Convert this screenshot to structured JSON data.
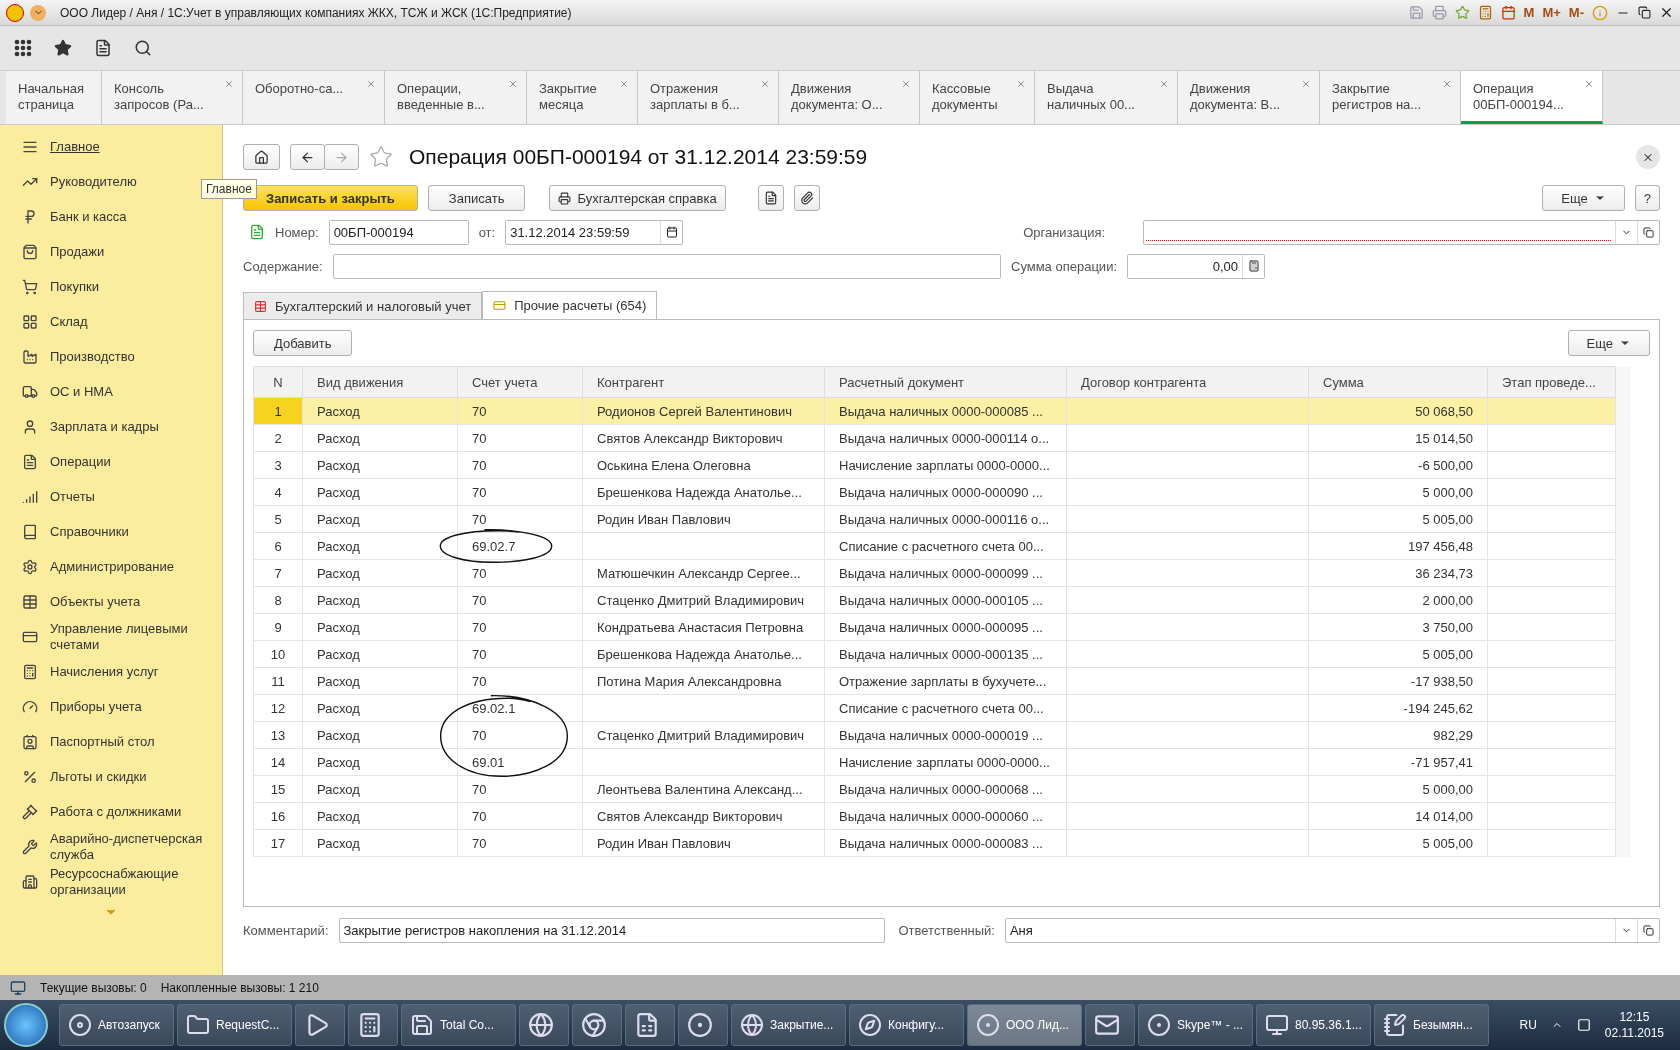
{
  "title_bar": {
    "title": "ООО Лидер / Аня / 1С:Учет в управляющих компаниях ЖКХ, ТСЖ и ЖСК  (1С:Предприятие)",
    "memory_buttons": [
      "M",
      "M+",
      "M-"
    ]
  },
  "open_tabs": [
    {
      "lines": [
        "Начальная",
        "страница"
      ],
      "closable": false,
      "selected": false
    },
    {
      "lines": [
        "Консоль",
        "запросов (Ра..."
      ],
      "closable": true,
      "selected": false
    },
    {
      "lines": [
        "Оборотно-са..."
      ],
      "closable": true,
      "selected": false
    },
    {
      "lines": [
        "Операции,",
        "введенные в..."
      ],
      "closable": true,
      "selected": false
    },
    {
      "lines": [
        "Закрытие",
        "месяца"
      ],
      "closable": true,
      "selected": false
    },
    {
      "lines": [
        "Отражения",
        "зарплаты в б..."
      ],
      "closable": true,
      "selected": false
    },
    {
      "lines": [
        "Движения",
        "документа: О..."
      ],
      "closable": true,
      "selected": false
    },
    {
      "lines": [
        "Кассовые",
        "документы"
      ],
      "closable": true,
      "selected": false
    },
    {
      "lines": [
        "Выдача",
        "наличных 00..."
      ],
      "closable": true,
      "selected": false
    },
    {
      "lines": [
        "Движения",
        "документа: В..."
      ],
      "closable": true,
      "selected": false
    },
    {
      "lines": [
        "Закрытие",
        "регистров на..."
      ],
      "closable": true,
      "selected": false
    },
    {
      "lines": [
        "Операция",
        "00БП-000194..."
      ],
      "closable": true,
      "selected": true
    }
  ],
  "sidebar": {
    "items": [
      {
        "label": "Главное",
        "selected": true
      },
      {
        "label": "Руководителю",
        "selected": false
      },
      {
        "label": "Банк и касса",
        "selected": false
      },
      {
        "label": "Продажи",
        "selected": false
      },
      {
        "label": "Покупки",
        "selected": false
      },
      {
        "label": "Склад",
        "selected": false
      },
      {
        "label": "Производство",
        "selected": false
      },
      {
        "label": "ОС и НМА",
        "selected": false
      },
      {
        "label": "Зарплата и кадры",
        "selected": false
      },
      {
        "label": "Операции",
        "selected": false
      },
      {
        "label": "Отчеты",
        "selected": false
      },
      {
        "label": "Справочники",
        "selected": false
      },
      {
        "label": "Администрирование",
        "selected": false
      },
      {
        "label": "Объекты учета",
        "selected": false
      },
      {
        "label": "Управление лицевыми счетами",
        "selected": false
      },
      {
        "label": "Начисления услуг",
        "selected": false
      },
      {
        "label": "Приборы учета",
        "selected": false
      },
      {
        "label": "Паспортный стол",
        "selected": false
      },
      {
        "label": "Льготы и скидки",
        "selected": false
      },
      {
        "label": "Работа с должниками",
        "selected": false
      },
      {
        "label": "Аварийно-диспетчерская служба",
        "selected": false
      },
      {
        "label": "Ресурсоснабжающие организации",
        "selected": false
      }
    ],
    "tooltip": "Главное"
  },
  "form": {
    "title": "Операция 00БП-000194 от 31.12.2014 23:59:59",
    "commands": {
      "save_close": "Записать и закрыть",
      "save": "Записать",
      "report": "Бухгалтерская справка",
      "more": "Еще",
      "help": "?"
    },
    "number_label": "Номер:",
    "number": "00БП-000194",
    "date_label": "от:",
    "date": "31.12.2014 23:59:59",
    "organization_label": "Организация:",
    "organization_required": true,
    "content_label": "Содержание:",
    "sum_label": "Сумма операции:",
    "sum": "0,00",
    "tabs": [
      {
        "label": "Бухгалтерский и налоговый учет",
        "selected": false
      },
      {
        "label": "Прочие расчеты (654)",
        "selected": true
      }
    ],
    "add_button": "Добавить",
    "table_more": "Еще",
    "columns": [
      "N",
      "Вид движения",
      "Счет учета",
      "Контрагент",
      "Расчетный документ",
      "Договор контрагента",
      "Сумма",
      "Этап проведе..."
    ],
    "rows": [
      {
        "n": "1",
        "movement": "Расход",
        "account": "70",
        "counterparty": "Родионов Сергей Валентинович",
        "document": "Выдача наличных 0000-000085 ...",
        "amount": "50 068,50",
        "selected": true
      },
      {
        "n": "2",
        "movement": "Расход",
        "account": "70",
        "counterparty": "Святов Александр Викторович",
        "document": "Выдача наличных 0000-000114 о...",
        "amount": "15 014,50",
        "selected": false
      },
      {
        "n": "3",
        "movement": "Расход",
        "account": "70",
        "counterparty": "Оськина Елена Олеговна",
        "document": "Начисление зарплаты 0000-0000...",
        "amount": "-6 500,00",
        "selected": false
      },
      {
        "n": "4",
        "movement": "Расход",
        "account": "70",
        "counterparty": "Брешенкова Надежда Анатолье...",
        "document": "Выдача наличных 0000-000090 ...",
        "amount": "5 000,00",
        "selected": false
      },
      {
        "n": "5",
        "movement": "Расход",
        "account": "70",
        "counterparty": "Родин Иван Павлович",
        "document": "Выдача наличных 0000-000116 о...",
        "amount": "5 005,00",
        "selected": false
      },
      {
        "n": "6",
        "movement": "Расход",
        "account": "69.02.7",
        "document": "Списание с расчетного счета 00...",
        "amount": "197 456,48",
        "selected": false
      },
      {
        "n": "7",
        "movement": "Расход",
        "account": "70",
        "counterparty": "Матюшечкин Александр Сергее...",
        "document": "Выдача наличных 0000-000099 ...",
        "amount": "36 234,73",
        "selected": false
      },
      {
        "n": "8",
        "movement": "Расход",
        "account": "70",
        "counterparty": "Стаценко Дмитрий Владимирович",
        "document": "Выдача наличных 0000-000105 ...",
        "amount": "2 000,00",
        "selected": false
      },
      {
        "n": "9",
        "movement": "Расход",
        "account": "70",
        "counterparty": "Кондратьева Анастасия Петровна",
        "document": "Выдача наличных 0000-000095 ...",
        "amount": "3 750,00",
        "selected": false
      },
      {
        "n": "10",
        "movement": "Расход",
        "account": "70",
        "counterparty": "Брешенкова Надежда Анатолье...",
        "document": "Выдача наличных 0000-000135 ...",
        "amount": "5 005,00",
        "selected": false
      },
      {
        "n": "11",
        "movement": "Расход",
        "account": "70",
        "counterparty": "Потина Мария Александровна",
        "document": "Отражение зарплаты в бухучете...",
        "amount": "-17 938,50",
        "selected": false
      },
      {
        "n": "12",
        "movement": "Расход",
        "account": "69.02.1",
        "document": "Списание с расчетного счета 00...",
        "amount": "-194 245,62",
        "selected": false
      },
      {
        "n": "13",
        "movement": "Расход",
        "account": "70",
        "counterparty": "Стаценко Дмитрий Владимирович",
        "document": "Выдача наличных 0000-000019 ...",
        "amount": "982,29",
        "selected": false
      },
      {
        "n": "14",
        "movement": "Расход",
        "account": "69.01",
        "document": "Начисление зарплаты 0000-0000...",
        "amount": "-71 957,41",
        "selected": false
      },
      {
        "n": "15",
        "movement": "Расход",
        "account": "70",
        "counterparty": "Леонтьева Валентина Александ...",
        "document": "Выдача наличных 0000-000068 ...",
        "amount": "5 000,00",
        "selected": false
      },
      {
        "n": "16",
        "movement": "Расход",
        "account": "70",
        "counterparty": "Святов Александр Викторович",
        "document": "Выдача наличных 0000-000060 ...",
        "amount": "14 014,00",
        "selected": false
      },
      {
        "n": "17",
        "movement": "Расход",
        "account": "70",
        "counterparty": "Родин Иван Павлович",
        "document": "Выдача наличных 0000-000083 ...",
        "amount": "5 005,00",
        "selected": false
      }
    ],
    "comment_label": "Комментарий:",
    "comment": "Закрытие регистров накопления на 31.12.2014",
    "responsible_label": "Ответственный:",
    "responsible": "Аня"
  },
  "status_bar": {
    "current_calls": "Текущие вызовы: 0",
    "accumulated_calls": "Накопленные вызовы: 1 210"
  },
  "taskbar": {
    "items": [
      {
        "kind": "button",
        "label": "Автозапуск",
        "active": false
      },
      {
        "kind": "button",
        "label": "RequestC...",
        "active": false
      },
      {
        "kind": "icon",
        "active": false
      },
      {
        "kind": "icon",
        "active": false
      },
      {
        "kind": "button",
        "label": "Total Co...",
        "active": false
      },
      {
        "kind": "icon",
        "active": false
      },
      {
        "kind": "icon",
        "active": false
      },
      {
        "kind": "icon",
        "active": false
      },
      {
        "kind": "icon",
        "active": false
      },
      {
        "kind": "button",
        "label": "Закрытие...",
        "active": false
      },
      {
        "kind": "button",
        "label": "Конфигу...",
        "active": false
      },
      {
        "kind": "button",
        "label": "ООО Лид...",
        "active": true
      },
      {
        "kind": "icon",
        "active": false
      },
      {
        "kind": "button",
        "label": "Skype™ - ...",
        "active": false
      },
      {
        "kind": "button",
        "label": "80.95.36.1...",
        "active": false
      },
      {
        "kind": "button",
        "label": "Безымян...",
        "active": false
      }
    ],
    "language": "RU",
    "time": "12:15",
    "date": "02.11.2015"
  }
}
